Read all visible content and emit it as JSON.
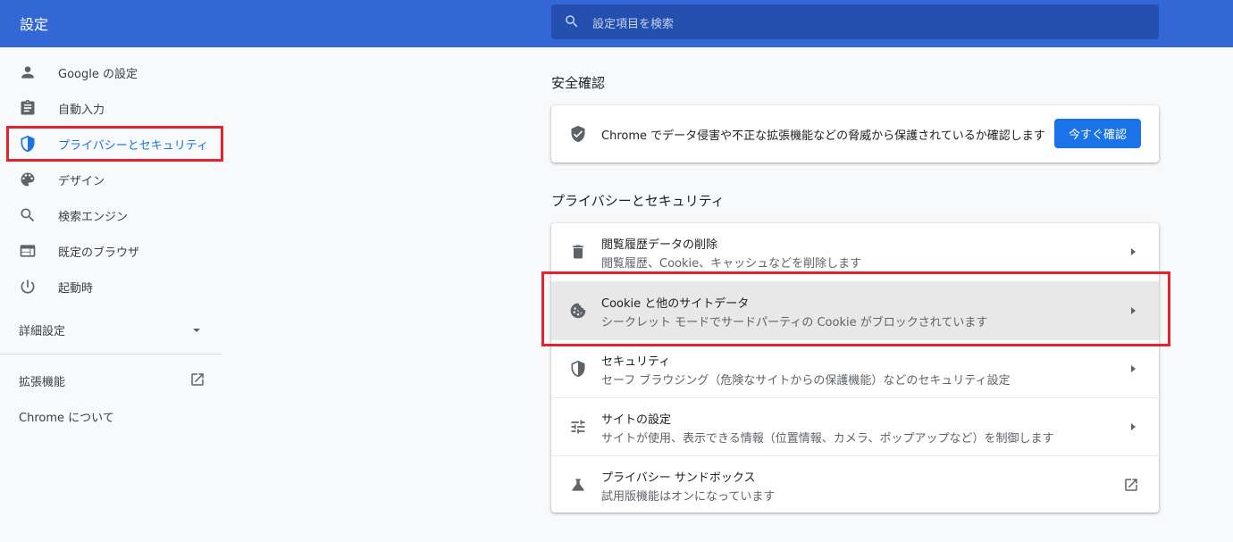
{
  "header": {
    "title": "設定",
    "search_placeholder": "設定項目を検索"
  },
  "sidebar": {
    "items": [
      {
        "label": "Google の設定",
        "icon": "person-icon"
      },
      {
        "label": "自動入力",
        "icon": "clipboard-icon"
      },
      {
        "label": "プライバシーとセキュリティ",
        "icon": "shield-icon",
        "active": true
      },
      {
        "label": "デザイン",
        "icon": "palette-icon"
      },
      {
        "label": "検索エンジン",
        "icon": "search-icon"
      },
      {
        "label": "既定のブラウザ",
        "icon": "browser-icon"
      },
      {
        "label": "起動時",
        "icon": "power-icon"
      }
    ],
    "advanced_label": "詳細設定",
    "extensions_label": "拡張機能",
    "about_label": "Chrome について"
  },
  "safety_check": {
    "section_title": "安全確認",
    "text": "Chrome でデータ侵害や不正な拡張機能などの脅威から保護されているか確認します",
    "button_label": "今すぐ確認"
  },
  "privacy": {
    "section_title": "プライバシーとセキュリティ",
    "rows": [
      {
        "title": "閲覧履歴データの削除",
        "subtitle": "閲覧履歴、Cookie、キャッシュなどを削除します",
        "icon": "trash-icon"
      },
      {
        "title": "Cookie と他のサイトデータ",
        "subtitle": "シークレット モードでサードパーティの Cookie がブロックされています",
        "icon": "cookie-icon"
      },
      {
        "title": "セキュリティ",
        "subtitle": "セーフ ブラウジング（危険なサイトからの保護機能）などのセキュリティ設定",
        "icon": "shield-icon"
      },
      {
        "title": "サイトの設定",
        "subtitle": "サイトが使用、表示できる情報（位置情報、カメラ、ポップアップなど）を制御します",
        "icon": "tune-icon"
      },
      {
        "title": "プライバシー サンドボックス",
        "subtitle": "試用版機能はオンになっています",
        "icon": "flask-icon"
      }
    ]
  },
  "colors": {
    "header_bg": "#3367d6",
    "accent": "#1a73e8",
    "highlight_border": "#e3232e"
  }
}
